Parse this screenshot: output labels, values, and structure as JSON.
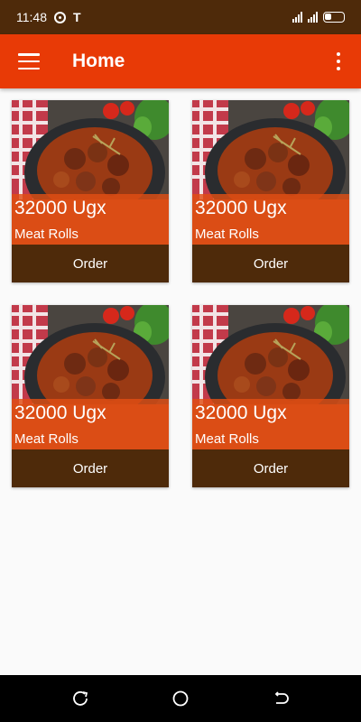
{
  "status_bar": {
    "time": "11:48",
    "icons": [
      "target-icon",
      "t-icon",
      "signal-icon",
      "battery-icon"
    ]
  },
  "app_bar": {
    "title": "Home",
    "menu_icon": "hamburger-menu-icon",
    "more_icon": "overflow-menu-icon",
    "color": "#e83a06"
  },
  "products": [
    {
      "price": "32000 Ugx",
      "name": "Meat Rolls",
      "order_label": "Order"
    },
    {
      "price": "32000 Ugx",
      "name": "Meat Rolls",
      "order_label": "Order"
    },
    {
      "price": "32000 Ugx",
      "name": "Meat Rolls",
      "order_label": "Order"
    },
    {
      "price": "32000 Ugx",
      "name": "Meat Rolls",
      "order_label": "Order"
    }
  ],
  "colors": {
    "status_bar": "#4e2a0a",
    "order_button": "#4e2a0a",
    "price_overlay": "#e04e14"
  },
  "nav_bar": {
    "icons": [
      "recents-icon",
      "home-icon",
      "back-icon"
    ]
  }
}
